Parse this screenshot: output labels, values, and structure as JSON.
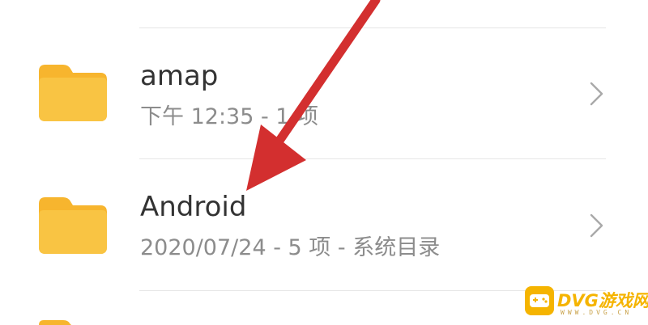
{
  "files": [
    {
      "name": "amap",
      "meta": "下午 12:35 - 1 项",
      "icon": "folder-icon"
    },
    {
      "name": "Android",
      "meta": "2020/07/24 - 5 项 - 系统目录",
      "icon": "folder-icon"
    }
  ],
  "watermark": {
    "text": "DVG游戏网",
    "sub": "WWW.DVG.CN"
  },
  "colors": {
    "folder": "#f9c443",
    "folder_tab": "#f7b52e",
    "arrow": "#d32f2f",
    "divider": "#e6e6e6",
    "watermark": "#f5b400"
  }
}
